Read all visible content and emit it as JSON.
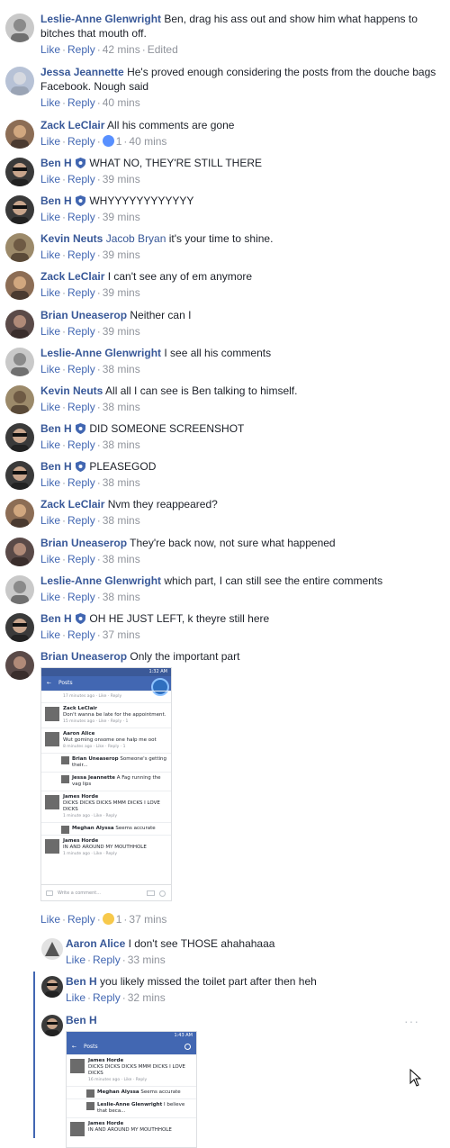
{
  "colors": {
    "author": "#385898",
    "link": "#4267b2",
    "meta": "#90949c",
    "text": "#1d2129",
    "badge": "#4267b2",
    "accent": "#3b5998"
  },
  "actions": {
    "like": "Like",
    "reply": "Reply",
    "dot": "·"
  },
  "comments": [
    {
      "author": "Leslie-Anne Glenwright",
      "text": "Ben, drag his ass out and show him what happens to bitches that mouth off.",
      "time": "42 mins",
      "extra": "Edited"
    },
    {
      "author": "Jessa Jeannette",
      "text": "He's proved enough considering the posts from the douche bags Facebook. Nough said",
      "time": "40 mins"
    },
    {
      "author": "Zack LeClair",
      "text": "All his comments are gone",
      "time": "40 mins",
      "reaction_count": "1",
      "reaction_icon": "like-icon"
    },
    {
      "author": "Ben H",
      "text": "WHAT NO, THEY'RE STILL THERE",
      "time": "39 mins",
      "badge_icon": "admin-badge-icon"
    },
    {
      "author": "Ben H",
      "text": "WHYYYYYYYYYYYY",
      "time": "39 mins",
      "badge_icon": "admin-badge-icon"
    },
    {
      "author": "Kevin Neuts",
      "mention": "Jacob Bryan",
      "text": "it's your time to shine.",
      "time": "39 mins"
    },
    {
      "author": "Zack LeClair",
      "text": "I can't see any of em anymore",
      "time": "39 mins"
    },
    {
      "author": "Brian Uneaserop",
      "text": "Neither can I",
      "time": "39 mins"
    },
    {
      "author": "Leslie-Anne Glenwright",
      "text": "I see all his comments",
      "time": "38 mins"
    },
    {
      "author": "Kevin Neuts",
      "text": "All all I can see is Ben talking to himself.",
      "time": "38 mins"
    },
    {
      "author": "Ben H",
      "text": "DID SOMEONE SCREENSHOT",
      "time": "38 mins",
      "badge_icon": "admin-badge-icon"
    },
    {
      "author": "Ben H",
      "text": "PLEASEGOD",
      "time": "38 mins",
      "badge_icon": "admin-badge-icon"
    },
    {
      "author": "Zack LeClair",
      "text": "Nvm they reappeared?",
      "time": "38 mins"
    },
    {
      "author": "Brian Uneaserop",
      "text": "They're back now, not sure what happened",
      "time": "38 mins"
    },
    {
      "author": "Leslie-Anne Glenwright",
      "text": "which part, I can still see the entire comments",
      "time": "38 mins"
    },
    {
      "author": "Ben H",
      "text": "OH HE JUST LEFT, k theyre still here",
      "time": "37 mins",
      "badge_icon": "admin-badge-icon"
    },
    {
      "author": "Brian Uneaserop",
      "text": "Only the important part",
      "time": "37 mins",
      "reaction_count": "1",
      "reaction_icon": "haha-icon"
    }
  ],
  "replies": [
    {
      "author": "Aaron Alice",
      "text": "I don't see THOSE ahahahaaa",
      "time": "33 mins"
    },
    {
      "author": "Ben H",
      "text": "you likely missed the toilet part after then heh",
      "time": "32 mins"
    },
    {
      "author": "Ben H"
    }
  ],
  "screenshot1": {
    "status": "1:32 AM",
    "header": "Posts",
    "top_meta": "17 minutes ago · Like · Reply",
    "rows": [
      {
        "name": "Zack LeClair",
        "text": "Don't wanna be late for the appointment.",
        "meta": "15 minutes ago · Like · Reply · 1"
      },
      {
        "name": "Aaron Alice",
        "text": "Wut goming onsome one halp me oot",
        "meta": "8 minutes ago · Like · Reply · 1"
      },
      {
        "name": "Brian Uneaserop",
        "text": "Someone's getting their..."
      },
      {
        "name": "Jessa Jeannette",
        "text": "A Fag running the vag lips"
      },
      {
        "name": "James Horde",
        "text": "DICKS DICKS DICKS MMM DICKS I LOVE DICKS",
        "meta": "1 minute ago · Like · Reply"
      },
      {
        "name": "Meghan Alyssa",
        "text": "Seems accurate"
      },
      {
        "name": "James Horde",
        "text": "IN AND AROUND MY MOUTHHOLE",
        "meta": "1 minute ago · Like · Reply"
      }
    ],
    "write": "Write a comment..."
  },
  "screenshot2": {
    "status": "1:43 AM",
    "header": "Posts",
    "rows": [
      {
        "name": "James Horde",
        "text": "DICKS DICKS DICKS MMM DICKS I LOVE DICKS",
        "meta": "16 minutes ago · Like · Reply"
      },
      {
        "name": "Meghan Alyssa",
        "text": "Seems accurate"
      },
      {
        "name": "Leslie-Anne Glenwright",
        "text": "I believe that beca..."
      },
      {
        "name": "James Horde",
        "text": "IN AND AROUND MY MOUTHHOLE"
      }
    ]
  }
}
